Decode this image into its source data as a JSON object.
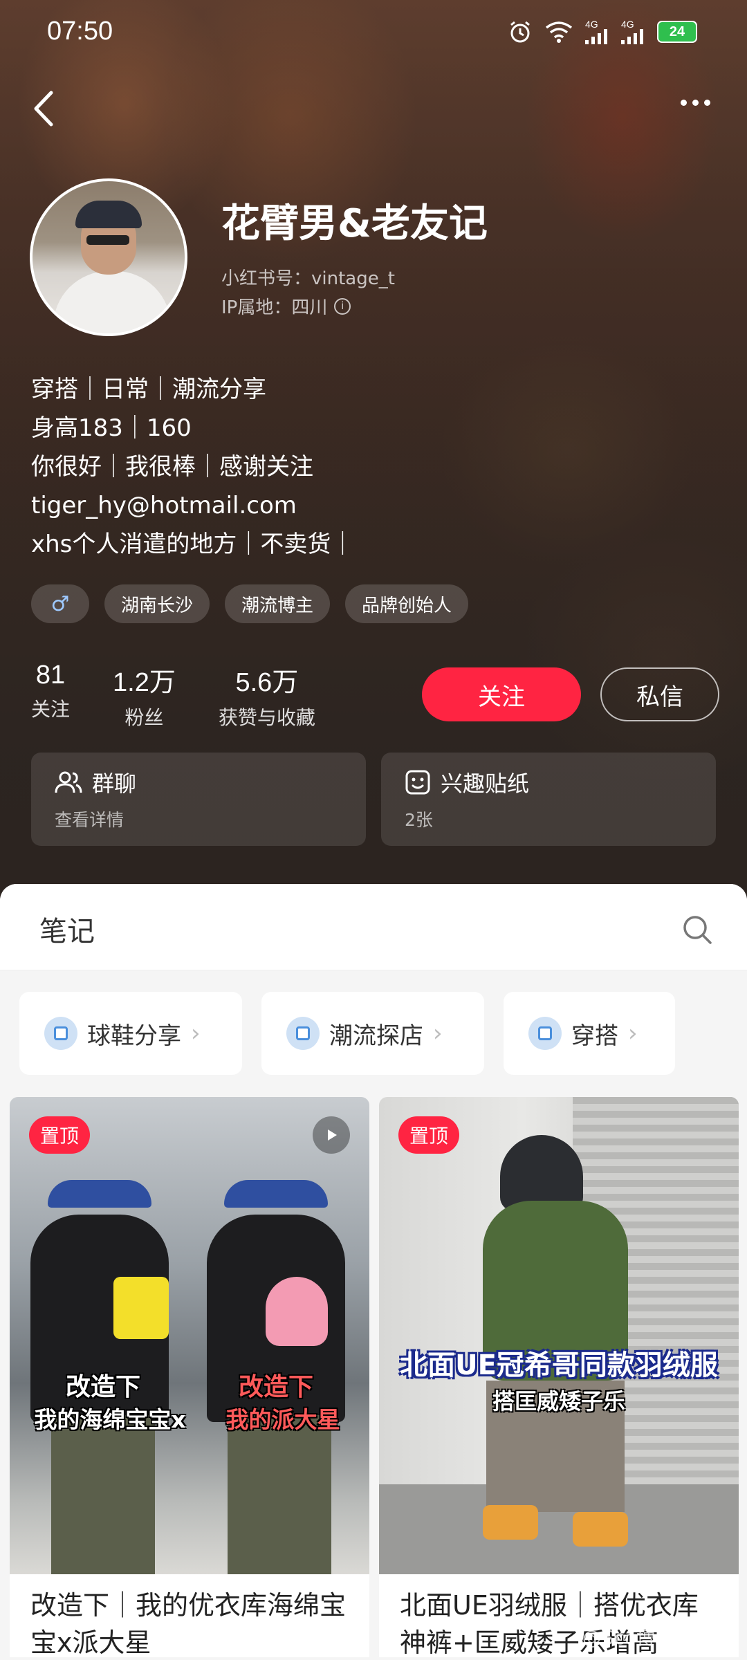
{
  "status": {
    "time": "07:50",
    "battery": "24",
    "signal1": "4G",
    "signal2": "4G"
  },
  "profile": {
    "name": "花臂男&老友记",
    "id_label": "小红书号：vintage_t",
    "ip_label": "IP属地：四川",
    "bio": [
      "穿搭｜日常｜潮流分享",
      "身高183｜160",
      "你很好｜我很棒｜感谢关注",
      "tiger_hy@hotmail.com",
      "xhs个人消遣的地方｜不卖货｜"
    ],
    "gender_symbol": "♂",
    "tags": [
      "湖南长沙",
      "潮流博主",
      "品牌创始人"
    ]
  },
  "stats": [
    {
      "num": "81",
      "label": "关注"
    },
    {
      "num": "1.2万",
      "label": "粉丝"
    },
    {
      "num": "5.6万",
      "label": "获赞与收藏"
    }
  ],
  "actions": {
    "follow": "关注",
    "message": "私信"
  },
  "cards": [
    {
      "title": "群聊",
      "sub": "查看详情",
      "icon": "group-icon"
    },
    {
      "title": "兴趣贴纸",
      "sub": "2张",
      "icon": "sticker-icon"
    }
  ],
  "tabs": {
    "notes": "笔记"
  },
  "collections": [
    {
      "label": "球鞋分享"
    },
    {
      "label": "潮流探店"
    },
    {
      "label": "穿搭"
    }
  ],
  "notes": [
    {
      "pin": "置顶",
      "overlay": [
        "改造下",
        "我的海绵宝宝x",
        "改造下",
        "我的派大星"
      ],
      "title": "改造下｜我的优衣库海绵宝宝x派大星"
    },
    {
      "pin": "置顶",
      "overlay": [
        "北面UE冠希哥同款羽绒服",
        "搭匡威矮子乐"
      ],
      "title": "北面UE羽绒服｜搭优衣库神裤+匡威矮子乐增高"
    }
  ],
  "watermark": "@Sco博士滴电车",
  "colors": {
    "accent": "#ff2442"
  }
}
